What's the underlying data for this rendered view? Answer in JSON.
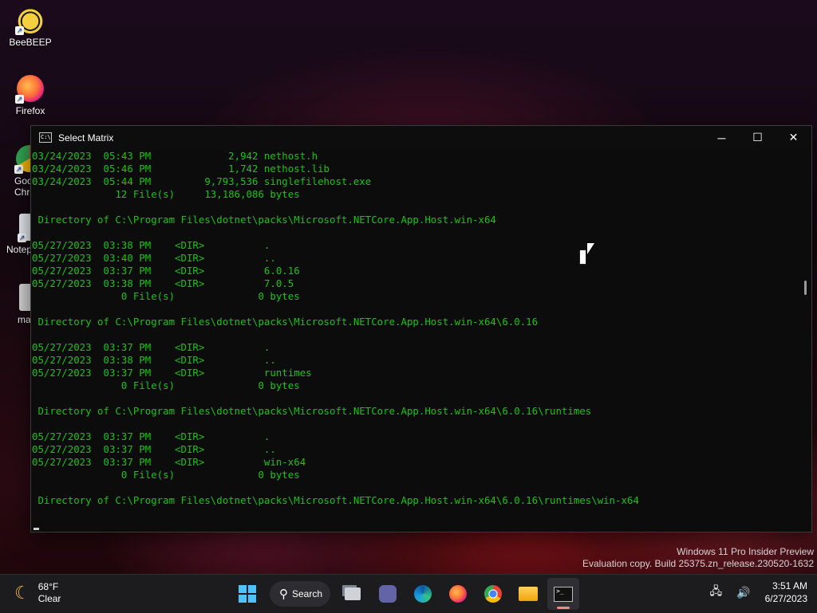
{
  "desktop": {
    "icons": [
      {
        "label": "BeeBEEP",
        "icon": "bee-app-icon"
      },
      {
        "label": "Firefox",
        "icon": "firefox-icon"
      },
      {
        "label": "Goo\nChro",
        "icon": "chrome-icon"
      },
      {
        "label": "Notep",
        "icon": "notepad-icon"
      },
      {
        "label": "ma",
        "icon": "file-icon"
      }
    ]
  },
  "window": {
    "title": "Select Matrix",
    "controls": {
      "minimize": "─",
      "maximize": "☐",
      "close": "✕"
    },
    "console_lines": [
      "03/24/2023  05:43 PM             2,942 nethost.h",
      "03/24/2023  05:46 PM             1,742 nethost.lib",
      "03/24/2023  05:44 PM         9,793,536 singlefilehost.exe",
      "              12 File(s)     13,186,086 bytes",
      "",
      " Directory of C:\\Program Files\\dotnet\\packs\\Microsoft.NETCore.App.Host.win-x64",
      "",
      "05/27/2023  03:38 PM    <DIR>          .",
      "05/27/2023  03:40 PM    <DIR>          ..",
      "05/27/2023  03:37 PM    <DIR>          6.0.16",
      "05/27/2023  03:38 PM    <DIR>          7.0.5",
      "               0 File(s)              0 bytes",
      "",
      " Directory of C:\\Program Files\\dotnet\\packs\\Microsoft.NETCore.App.Host.win-x64\\6.0.16",
      "",
      "05/27/2023  03:37 PM    <DIR>          .",
      "05/27/2023  03:38 PM    <DIR>          ..",
      "05/27/2023  03:37 PM    <DIR>          runtimes",
      "               0 File(s)              0 bytes",
      "",
      " Directory of C:\\Program Files\\dotnet\\packs\\Microsoft.NETCore.App.Host.win-x64\\6.0.16\\runtimes",
      "",
      "05/27/2023  03:37 PM    <DIR>          .",
      "05/27/2023  03:37 PM    <DIR>          ..",
      "05/27/2023  03:37 PM    <DIR>          win-x64",
      "               0 File(s)              0 bytes",
      "",
      " Directory of C:\\Program Files\\dotnet\\packs\\Microsoft.NETCore.App.Host.win-x64\\6.0.16\\runtimes\\win-x64"
    ],
    "text_color": "#16c60c"
  },
  "watermark": {
    "line1": "Windows 11 Pro Insider Preview",
    "line2": "Evaluation copy. Build 25375.zn_release.230520-1632"
  },
  "taskbar": {
    "weather": {
      "temp": "68°F",
      "condition": "Clear",
      "icon": "moon-icon"
    },
    "search_label": "Search",
    "apps": [
      "task-view-icon",
      "teams-chat-icon",
      "edge-icon",
      "firefox-icon",
      "chrome-icon",
      "file-explorer-icon",
      "terminal-icon"
    ],
    "clock": {
      "time": "3:51 AM",
      "date": "6/27/2023"
    }
  }
}
